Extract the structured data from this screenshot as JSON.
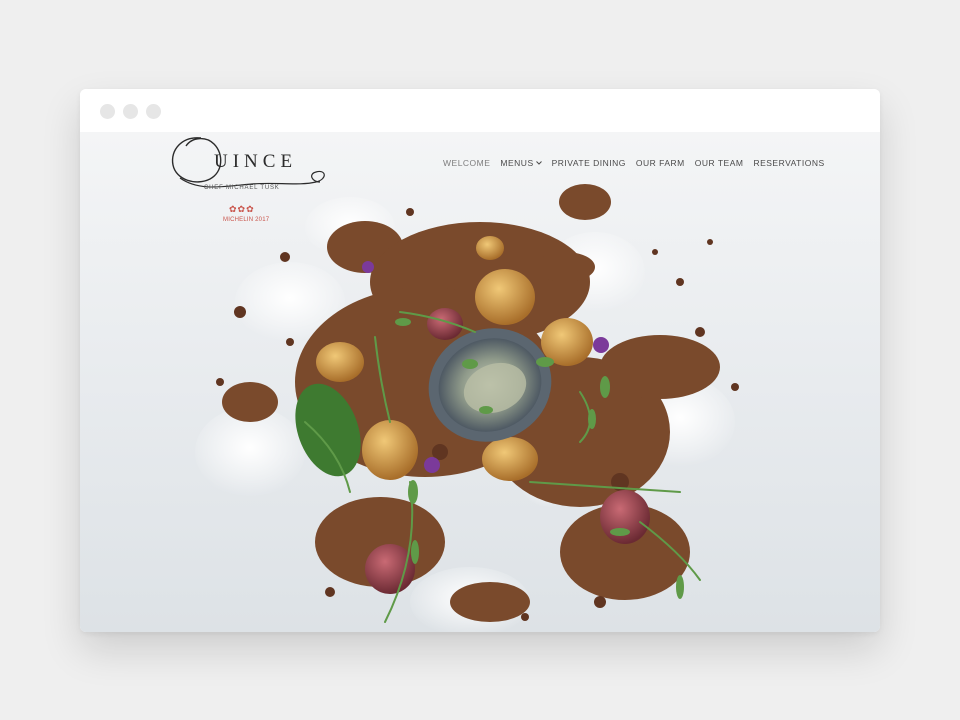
{
  "browser": {
    "dots": [
      "close-dot",
      "minimize-dot",
      "zoom-dot"
    ]
  },
  "brand": {
    "name": "QUINCE",
    "name_tail": "UINCE",
    "chef": "CHEF MICHAEL TUSK",
    "stars": "✿✿✿",
    "michelin": "MICHELIN 2017",
    "accent_color": "#c9544b"
  },
  "nav": {
    "items": [
      {
        "label": "WELCOME",
        "active": true
      },
      {
        "label": "MENUS",
        "has_dropdown": true
      },
      {
        "label": "PRIVATE DINING"
      },
      {
        "label": "OUR FARM"
      },
      {
        "label": "OUR TEAM"
      },
      {
        "label": "RESERVATIONS"
      }
    ],
    "dropdown_icon": "chevron-down-icon"
  },
  "hero": {
    "subject": "hero-image",
    "colors": {
      "background": "#e6e9ec",
      "crumble": "#7a4a2c",
      "greens": "#4f8a3a",
      "blossom": "#7b3a9a"
    }
  }
}
